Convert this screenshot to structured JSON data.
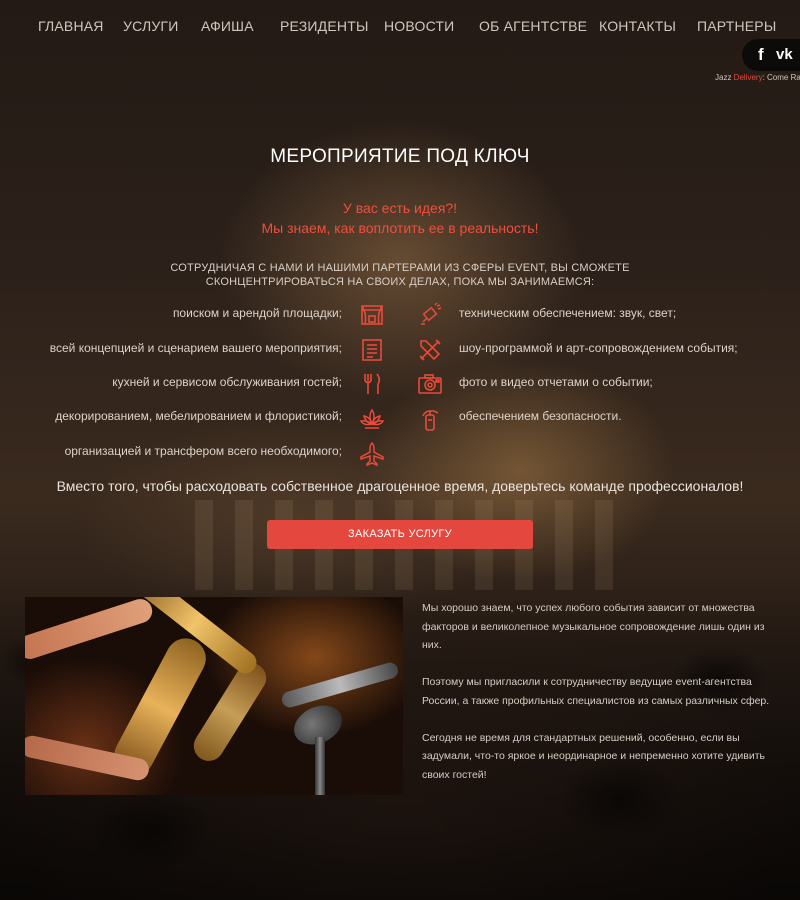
{
  "nav": {
    "items": [
      "ГЛАВНАЯ",
      "УСЛУГИ",
      "АФИША",
      "РЕЗИДЕНТЫ",
      "НОВОСТИ",
      "ОБ АГЕНТСТВЕ",
      "КОНТАКТЫ",
      "ПАРТНЕРЫ"
    ]
  },
  "social": {
    "facebook_glyph": "f",
    "vk_glyph": "vk",
    "icons": [
      "facebook-icon",
      "vk-icon"
    ]
  },
  "ticker": {
    "part1": "Jazz ",
    "part2": "Delivery",
    "part3": ": Come Rai"
  },
  "hero": {
    "title": "МЕРОПРИЯТИЕ ПОД КЛЮЧ",
    "tagline1": "У вас есть идея?!",
    "tagline2": "Мы знаем, как воплотить ее в реальность!",
    "intro": "СОТРУДНИЧАЯ С НАМИ И НАШИМИ ПАРТЕРАМИ ИЗ СФЕРЫ EVENT, ВЫ СМОЖЕТЕ СКОНЦЕНТРИРОВАТЬСЯ НА СВОИХ ДЕЛАХ, ПОКА МЫ ЗАНИМАЕМСЯ:"
  },
  "services": {
    "left": [
      {
        "text": "поиском и арендой площадки;",
        "icon": "stage-icon"
      },
      {
        "text": "всей концепцией и сценарием вашего мероприятия;",
        "icon": "script-icon"
      },
      {
        "text": "кухней и сервисом обслуживания гостей;",
        "icon": "cutlery-icon"
      },
      {
        "text": "декорированием, мебелированием и флористикой;",
        "icon": "lotus-icon"
      },
      {
        "text": "организацией и трансфером всего необходимого;",
        "icon": "airplane-icon"
      }
    ],
    "right": [
      {
        "text": "техническим обеспечением: звук, свет;",
        "icon": "spotlight-icon"
      },
      {
        "text": "шоу-программой и арт-сопровождением события;",
        "icon": "art-tools-icon"
      },
      {
        "text": "фото и видео отчетами о событии;",
        "icon": "camera-icon"
      },
      {
        "text": "обеспечением безопасности.",
        "icon": "fire-extinguisher-icon"
      }
    ],
    "icon_color": "#e84a3c"
  },
  "closing": "Вместо того, чтобы расходовать собственное драгоценное время, доверьтесь команде профессионалов!",
  "cta": {
    "label": "ЗАКАЗАТЬ УСЛУГУ",
    "color": "#e4473d"
  },
  "about": {
    "p1": "Мы хорошо знаем, что успех любого события зависит от множества факторов и великолепное музыкальное сопровождение лишь один из них.",
    "p2": "Поэтому мы пригласили к сотрудничеству ведущие event-агентства России, а также профильных специалистов из самых различных сфер.",
    "p3": "Сегодня не время для стандартных решений, особенно, если вы задумали, что-то яркое и неординарное и непременно хотите удивить своих гостей!"
  }
}
